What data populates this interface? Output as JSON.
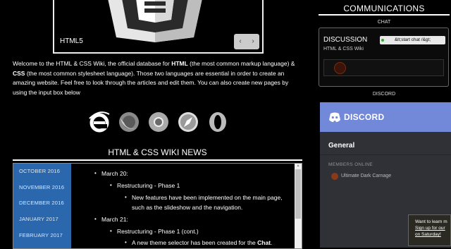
{
  "slideshow": {
    "caption": "HTML5",
    "prev": "‹",
    "next": "›"
  },
  "intro": {
    "t1": "Welcome to the HTML & CSS Wiki, the official database for ",
    "b1": "HTML",
    "t2": " (the most common markup language) & ",
    "b2": "CSS",
    "t3": " (the most common stylesheet language). Those two languages are essential in order to create an amazing website. Feel free to look through the articles and edit them. You can also create new pages by using the input box below"
  },
  "browsers": [
    "internet-explorer-icon",
    "firefox-icon",
    "chrome-icon",
    "safari-icon",
    "opera-icon"
  ],
  "news": {
    "title": "HTML & CSS WIKI NEWS",
    "months": [
      "OCTOBER 2016",
      "NOVEMBER 2016",
      "DECEMBER 2016",
      "JANUARY 2017",
      "FEBRUARY 2017"
    ],
    "l1": "March 20:",
    "l2": "Restructuring - Phase 1",
    "l3": "New features have been implemented on the main page,",
    "l4": "such as the slideshow and the navigation.",
    "l5": "March 21:",
    "l6": "Restructuring - Phase 1 (cont.)",
    "l7a": "A new theme selector has been created for the ",
    "l7b": "Chat",
    "l7c": "."
  },
  "communications": {
    "title": "COMMUNICATIONS",
    "chat_label": "CHAT",
    "discussion": "DISCUSSION",
    "wiki_name": "HTML & CSS Wiki",
    "start_chat": "&lt;start chat /&gt;",
    "discord_label": "DISCORD"
  },
  "discord": {
    "brand": "DISCORD",
    "server": "General",
    "members_heading": "MEMBERS ONLINE",
    "member": "Ultimate Dark Carnage"
  },
  "promo": {
    "l1": "Want to learn m",
    "l2": "Sign up for our",
    "l3": "on Saturday!"
  },
  "colors": {
    "month_tab_bg": "#2a67ad",
    "discord_blurple": "#7289da",
    "discord_dark": "#2f3136"
  }
}
